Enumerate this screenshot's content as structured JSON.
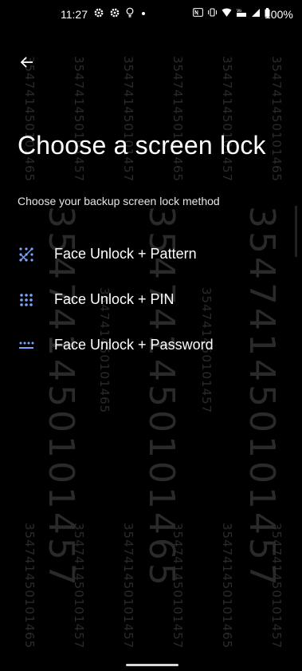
{
  "status_bar": {
    "time": "11:27",
    "battery_percent": "100%",
    "icons_left": [
      "gear-icon",
      "gear-icon",
      "bulb-icon",
      "dot-icon"
    ],
    "icons_right": [
      "nfc-icon",
      "vibrate-icon",
      "wifi-icon",
      "volte-icon",
      "signal-icon",
      "battery-icon"
    ]
  },
  "header": {
    "back_icon": "arrow-left-icon",
    "title": "Choose a screen lock",
    "subtitle": "Choose your backup screen lock method"
  },
  "options": [
    {
      "label": "Face Unlock + Pattern",
      "icon": "pattern-icon"
    },
    {
      "label": "Face Unlock + PIN",
      "icon": "pin-icon"
    },
    {
      "label": "Face Unlock + Password",
      "icon": "password-icon"
    }
  ],
  "watermark": {
    "text_small": "354741450101465",
    "text_small_alt": "354741450101457",
    "text_big_1": "354741450101457",
    "text_big_2": "354741450101465"
  },
  "colors": {
    "background": "#000000",
    "accent": "#7aa5ff",
    "text": "#ffffff",
    "watermark": "#2a2a2a"
  }
}
